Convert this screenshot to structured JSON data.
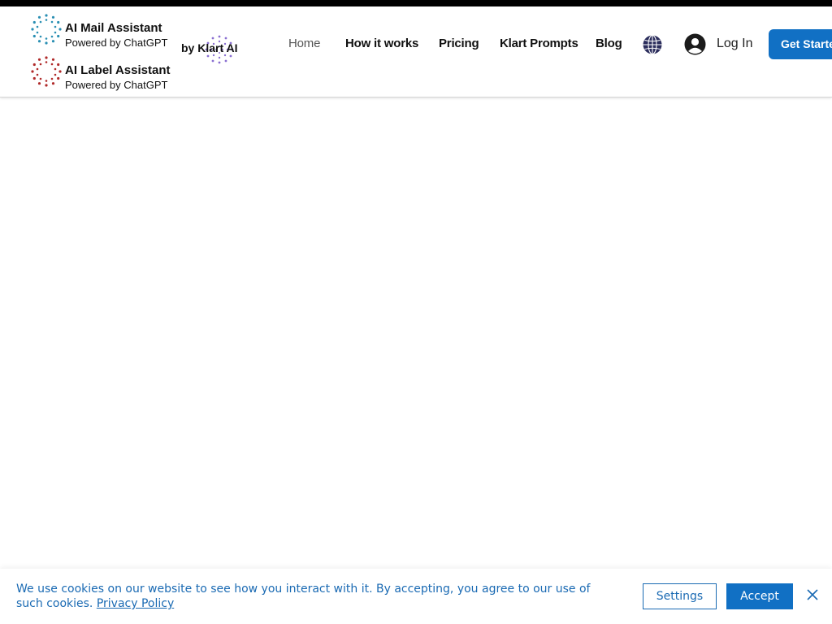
{
  "brand_mail": {
    "title": "AI Mail Assistant",
    "subtitle": "Powered by ChatGPT"
  },
  "brand_label": {
    "title": "AI Label Assistant",
    "subtitle": "Powered by ChatGPT"
  },
  "by_klart": "by Klart AI",
  "nav": {
    "home": "Home",
    "how_it_works": "How it works",
    "pricing": "Pricing",
    "klart_prompts": "Klart Prompts",
    "blog": "Blog"
  },
  "login_label": "Log In",
  "cta_label": "Get Started",
  "cookie": {
    "message": "We use cookies on our website to see how you interact with it. By accepting, you agree to our use of such cookies.",
    "privacy_link": "Privacy Policy",
    "settings_label": "Settings",
    "accept_label": "Accept"
  },
  "icons": {
    "globe": "globe-icon",
    "account": "account-icon",
    "close": "close-icon"
  },
  "colors": {
    "accent": "#1170c4",
    "mail_logo": "#2a8fb3",
    "label_logo": "#b02a2a",
    "klart_logo": "#8a6fd1"
  }
}
